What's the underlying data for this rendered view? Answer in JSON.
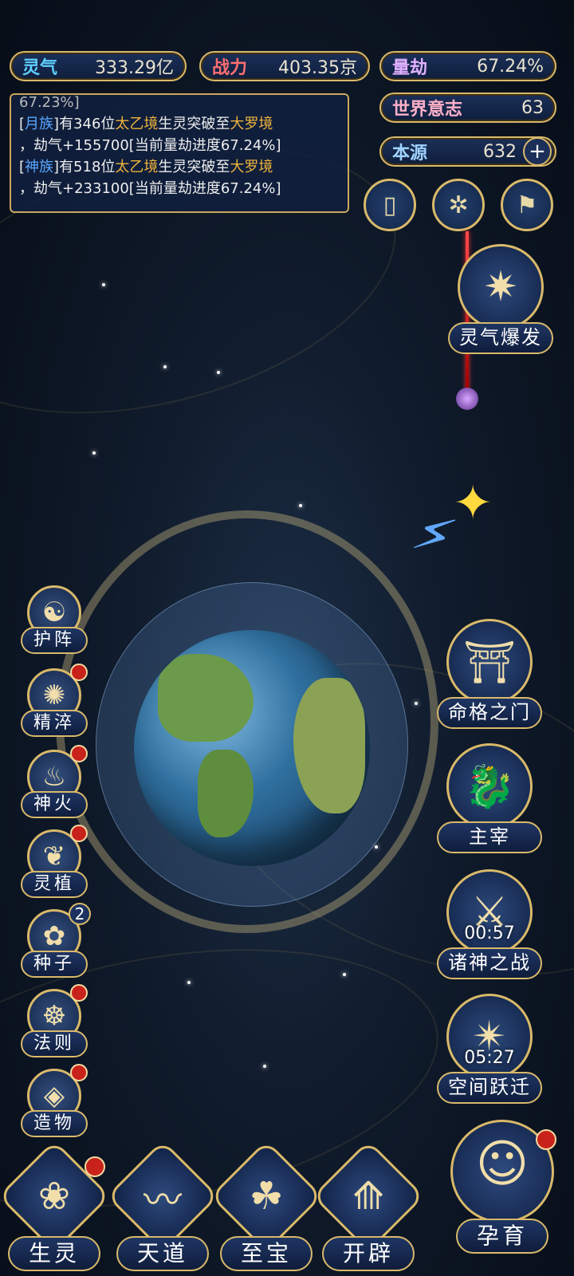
{
  "stats": {
    "lingqi": {
      "label": "灵气",
      "value": "333.29亿",
      "color": "#5fd0ff"
    },
    "zhanli": {
      "label": "战力",
      "value": "403.35京",
      "color": "#ff6f6f"
    },
    "liangjie": {
      "label": "量劫",
      "value": "67.24%",
      "color": "#e0b0ff"
    },
    "shijie": {
      "label": "世界意志",
      "value": "63",
      "color": "#ffb0c8"
    },
    "benyuan": {
      "label": "本源",
      "value": "632",
      "color": "#9fd3ff"
    }
  },
  "log": {
    "cut_line": "67.23%]",
    "entries": [
      {
        "race": "月族",
        "mid1": "有346位",
        "realm1": "太乙境",
        "mid2": "生灵突破至",
        "realm2": "大罗境",
        "line2": "，劫气+155700[当前量劫进度67.24%]"
      },
      {
        "race": "神族",
        "mid1": "有518位",
        "realm1": "太乙境",
        "mid2": "生灵突破至",
        "realm2": "大罗境",
        "line2": "，劫气+233100[当前量劫进度67.24%]"
      }
    ]
  },
  "top_icons": [
    "card-icon",
    "vortex-icon",
    "flag-icon"
  ],
  "burst_label": "灵气爆发",
  "left_menu": [
    {
      "label": "护阵",
      "icon": "☯",
      "dot": false,
      "badge": ""
    },
    {
      "label": "精淬",
      "icon": "✺",
      "dot": true,
      "badge": ""
    },
    {
      "label": "神火",
      "icon": "♨",
      "dot": true,
      "badge": ""
    },
    {
      "label": "灵植",
      "icon": "❦",
      "dot": true,
      "badge": ""
    },
    {
      "label": "种子",
      "icon": "✿",
      "dot": false,
      "badge": "2"
    },
    {
      "label": "法则",
      "icon": "☸",
      "dot": true,
      "badge": ""
    },
    {
      "label": "造物",
      "icon": "◈",
      "dot": true,
      "badge": ""
    }
  ],
  "right_menu": [
    {
      "label": "命格之门",
      "icon": "⛩",
      "timer": ""
    },
    {
      "label": "主宰",
      "icon": "🐉",
      "timer": ""
    },
    {
      "label": "诸神之战",
      "icon": "⚔",
      "timer": "00:57"
    },
    {
      "label": "空间跃迁",
      "icon": "✴",
      "timer": "05:27"
    }
  ],
  "bottom_nav": [
    {
      "label": "生灵",
      "icon": "❀",
      "dot": true
    },
    {
      "label": "天道",
      "icon": "〰",
      "dot": false
    },
    {
      "label": "至宝",
      "icon": "☘",
      "dot": false
    },
    {
      "label": "开辟",
      "icon": "⟰",
      "dot": false
    },
    {
      "label": "孕育",
      "icon": "☺",
      "dot": true
    }
  ]
}
